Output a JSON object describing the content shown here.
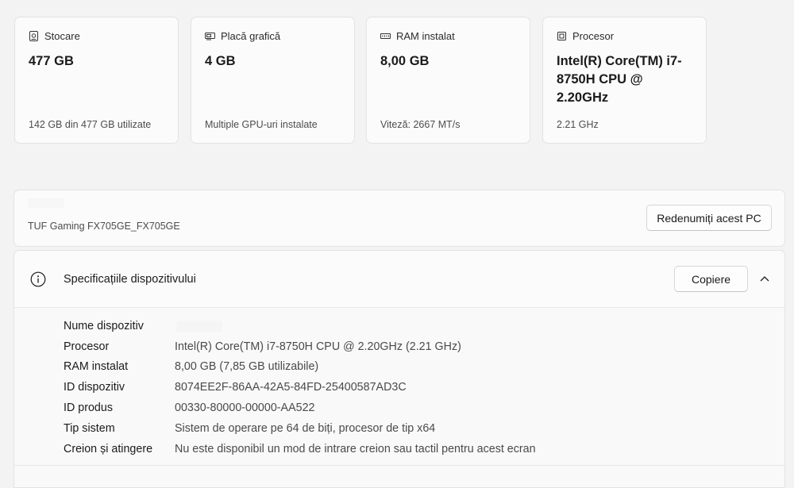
{
  "cards": [
    {
      "icon": "storage-icon",
      "title": "Stocare",
      "value": "477 GB",
      "sub": "142 GB din 477 GB utilizate"
    },
    {
      "icon": "graphics-card-icon",
      "title": "Placă grafică",
      "value": "4 GB",
      "sub": "Multiple GPU-uri instalate"
    },
    {
      "icon": "ram-icon",
      "title": "RAM instalat",
      "value": "8,00 GB",
      "sub": "Viteză: 2667 MT/s"
    },
    {
      "icon": "processor-icon",
      "title": "Procesor",
      "value": "Intel(R) Core(TM) i7-8750H CPU @ 2.20GHz",
      "sub": "2.21 GHz"
    }
  ],
  "pc": {
    "model": "TUF Gaming FX705GE_FX705GE",
    "rename_label": "Redenumiți acest PC"
  },
  "specs": {
    "title": "Specificațiile dispozitivului",
    "copy_label": "Copiere",
    "rows": [
      {
        "label": "Nume dispozitiv",
        "value": ""
      },
      {
        "label": "Procesor",
        "value": "Intel(R) Core(TM) i7-8750H CPU @ 2.20GHz (2.21 GHz)"
      },
      {
        "label": "RAM instalat",
        "value": "8,00 GB (7,85 GB utilizabile)"
      },
      {
        "label": "ID dispozitiv",
        "value": "8074EE2F-86AA-42A5-84FD-25400587AD3C"
      },
      {
        "label": "ID produs",
        "value": "00330-80000-00000-AA522"
      },
      {
        "label": "Tip sistem",
        "value": "Sistem de operare pe 64 de biți, procesor de tip x64"
      },
      {
        "label": "Creion și atingere",
        "value": "Nu este disponibil un mod de intrare creion sau tactil pentru acest ecran"
      }
    ]
  }
}
